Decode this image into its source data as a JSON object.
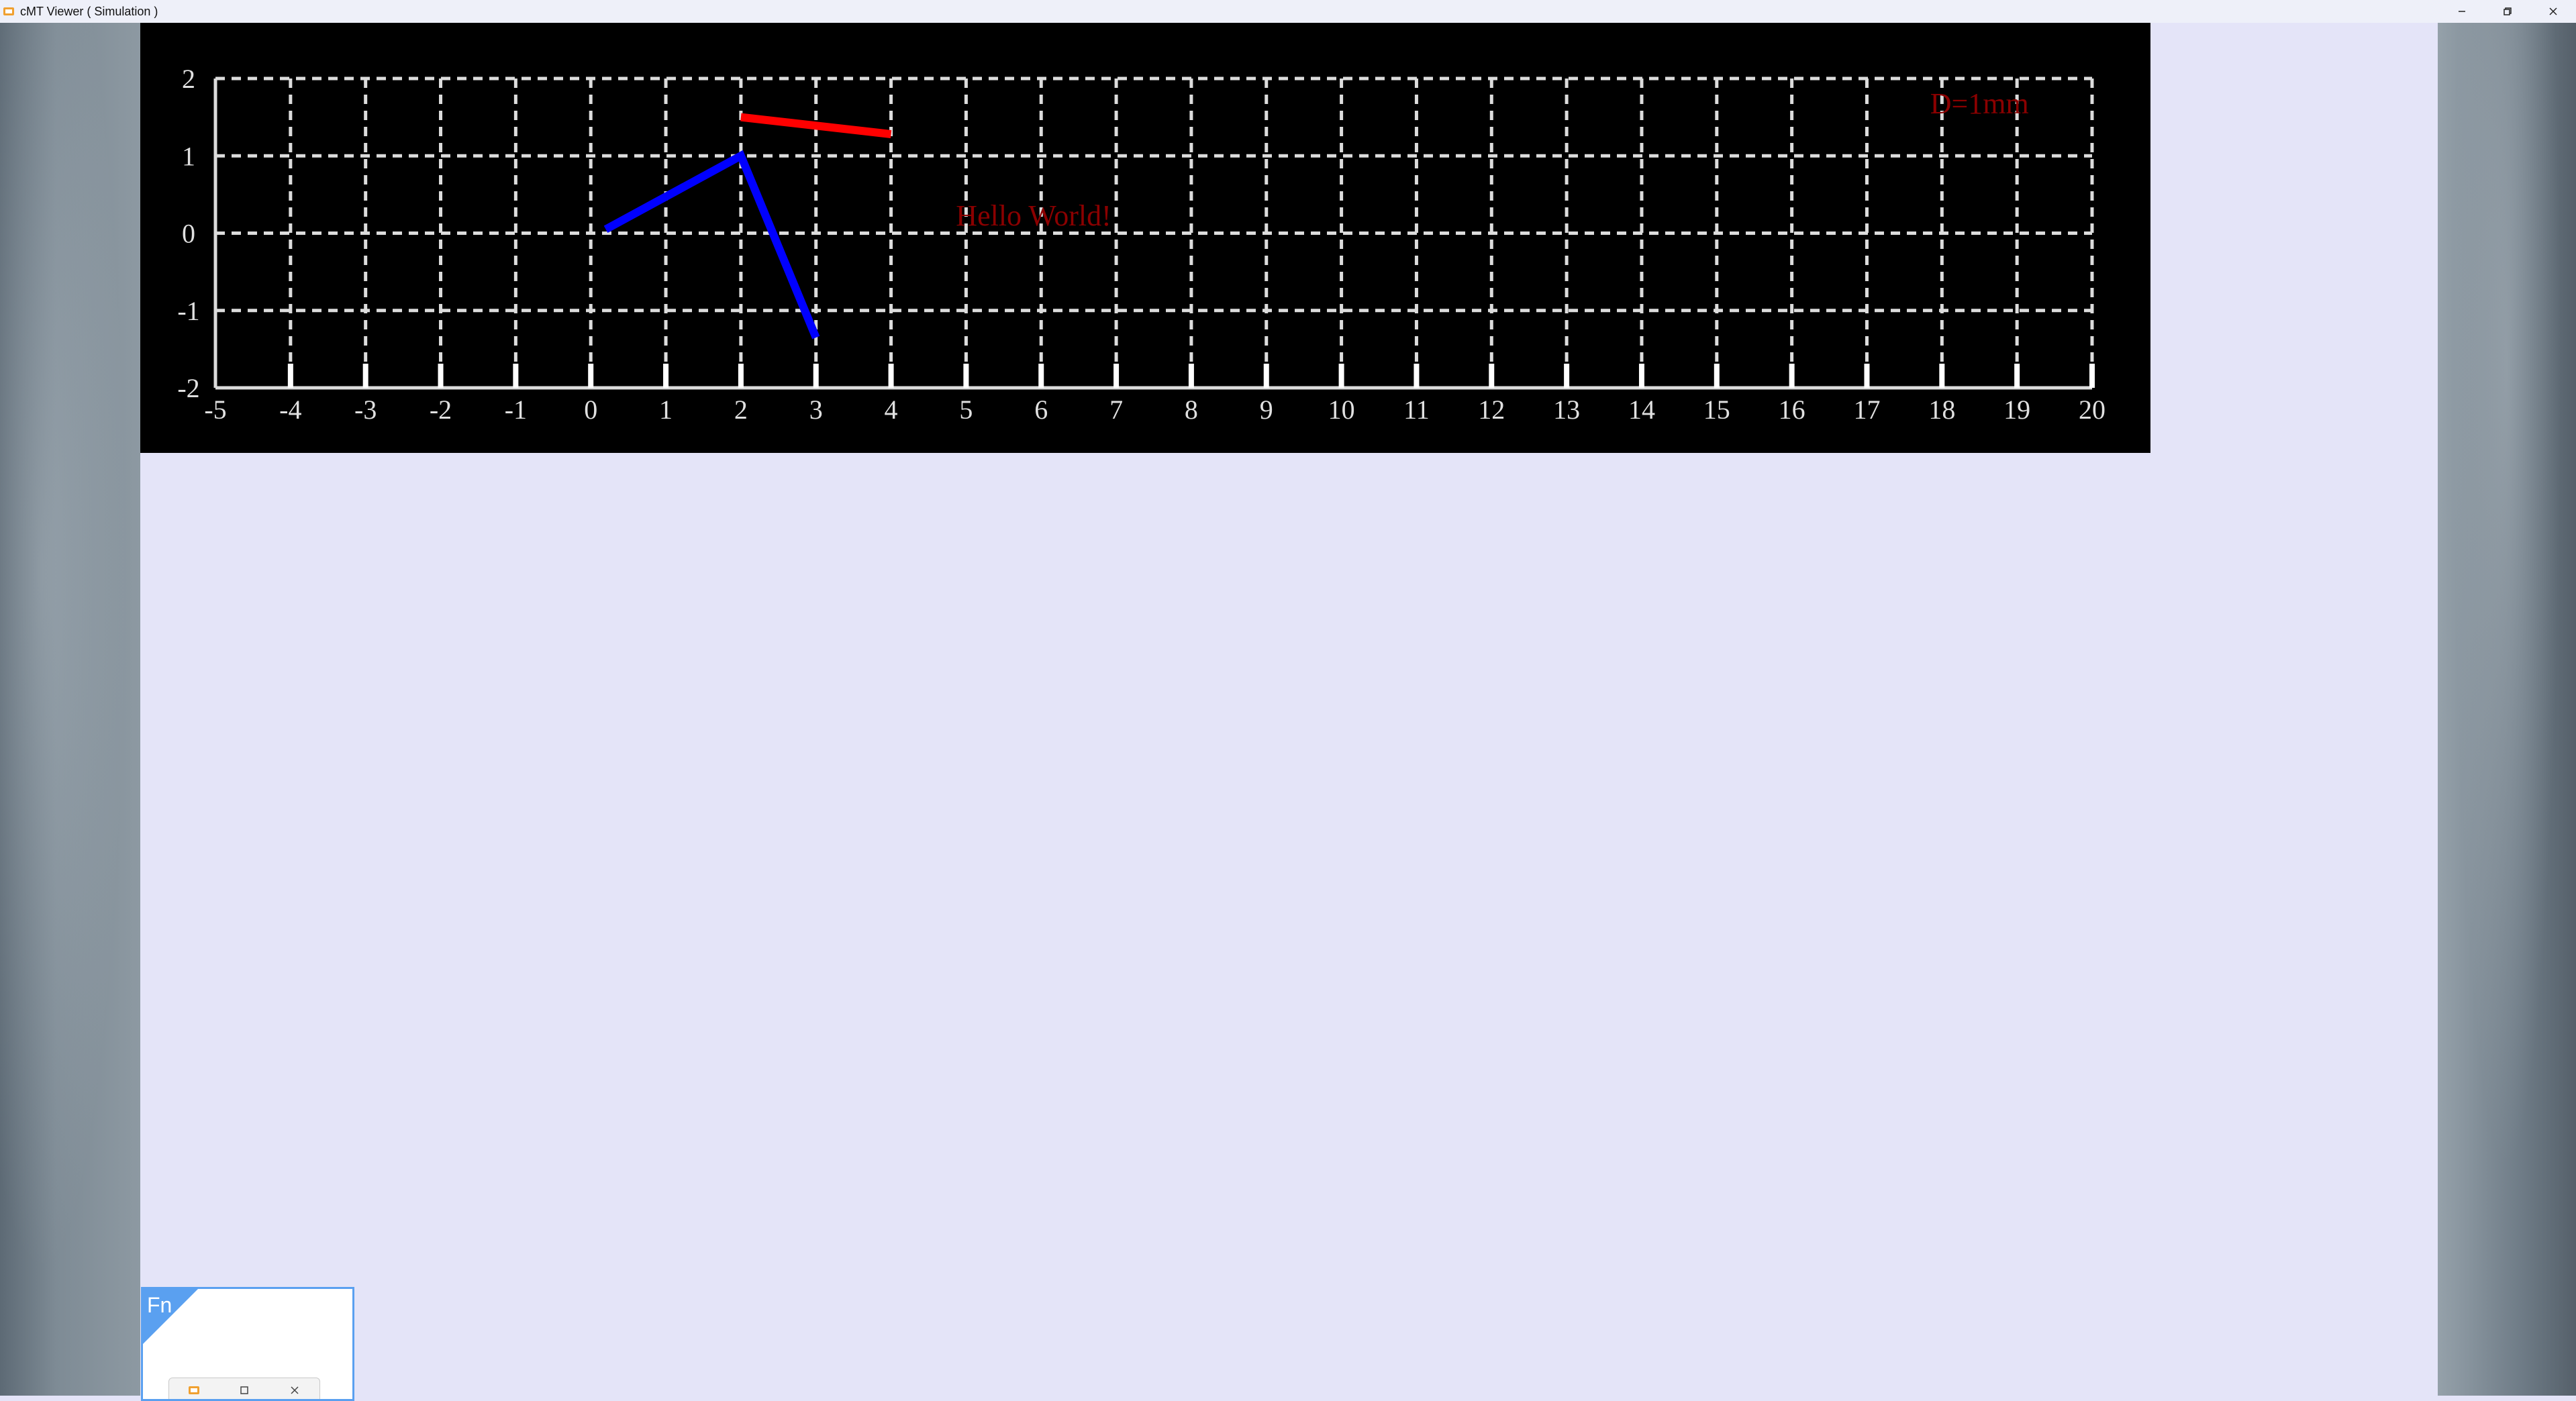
{
  "window": {
    "title": "cMT Viewer ( Simulation )",
    "icon": "cmt-viewer-app-icon",
    "controls": [
      "minimize-icon",
      "restore-icon",
      "close-icon"
    ]
  },
  "chart_data": {
    "type": "line",
    "x_tick_labels": [
      "-5",
      "-4",
      "-3",
      "-2",
      "-1",
      "0",
      "1",
      "2",
      "3",
      "4",
      "5",
      "6",
      "7",
      "8",
      "9",
      "10",
      "11",
      "12",
      "13",
      "14",
      "15",
      "16",
      "17",
      "18",
      "19",
      "20"
    ],
    "y_tick_labels": [
      "2",
      "1",
      "0",
      "-1",
      "-2"
    ],
    "xlim": [
      -5,
      20
    ],
    "ylim": [
      -2,
      2
    ],
    "grid": true,
    "grid_style": "dashed",
    "background": "#000000",
    "series": [
      {
        "color": "#0000ff",
        "points": [
          [
            0.2,
            0.05
          ],
          [
            2,
            1
          ],
          [
            3,
            -1.35
          ]
        ]
      },
      {
        "color": "#ff0000",
        "points": [
          [
            2,
            1.5
          ],
          [
            4,
            1.28
          ]
        ]
      }
    ],
    "annotations": [
      {
        "text": "Hello World!",
        "x": 5.9,
        "y": 0.1,
        "color": "#8b0000"
      },
      {
        "text": "D=1mm",
        "x": 18.5,
        "y": 1.55,
        "color": "#8b0000"
      }
    ]
  },
  "fn_panel": {
    "label": "Fn",
    "taskbar_icons": [
      "app-icon",
      "restore-icon",
      "close-icon"
    ]
  },
  "colors": {
    "accent": "#5aa0f0",
    "main_background": "#e4e4f8",
    "titlebar": "#eef0f9"
  }
}
